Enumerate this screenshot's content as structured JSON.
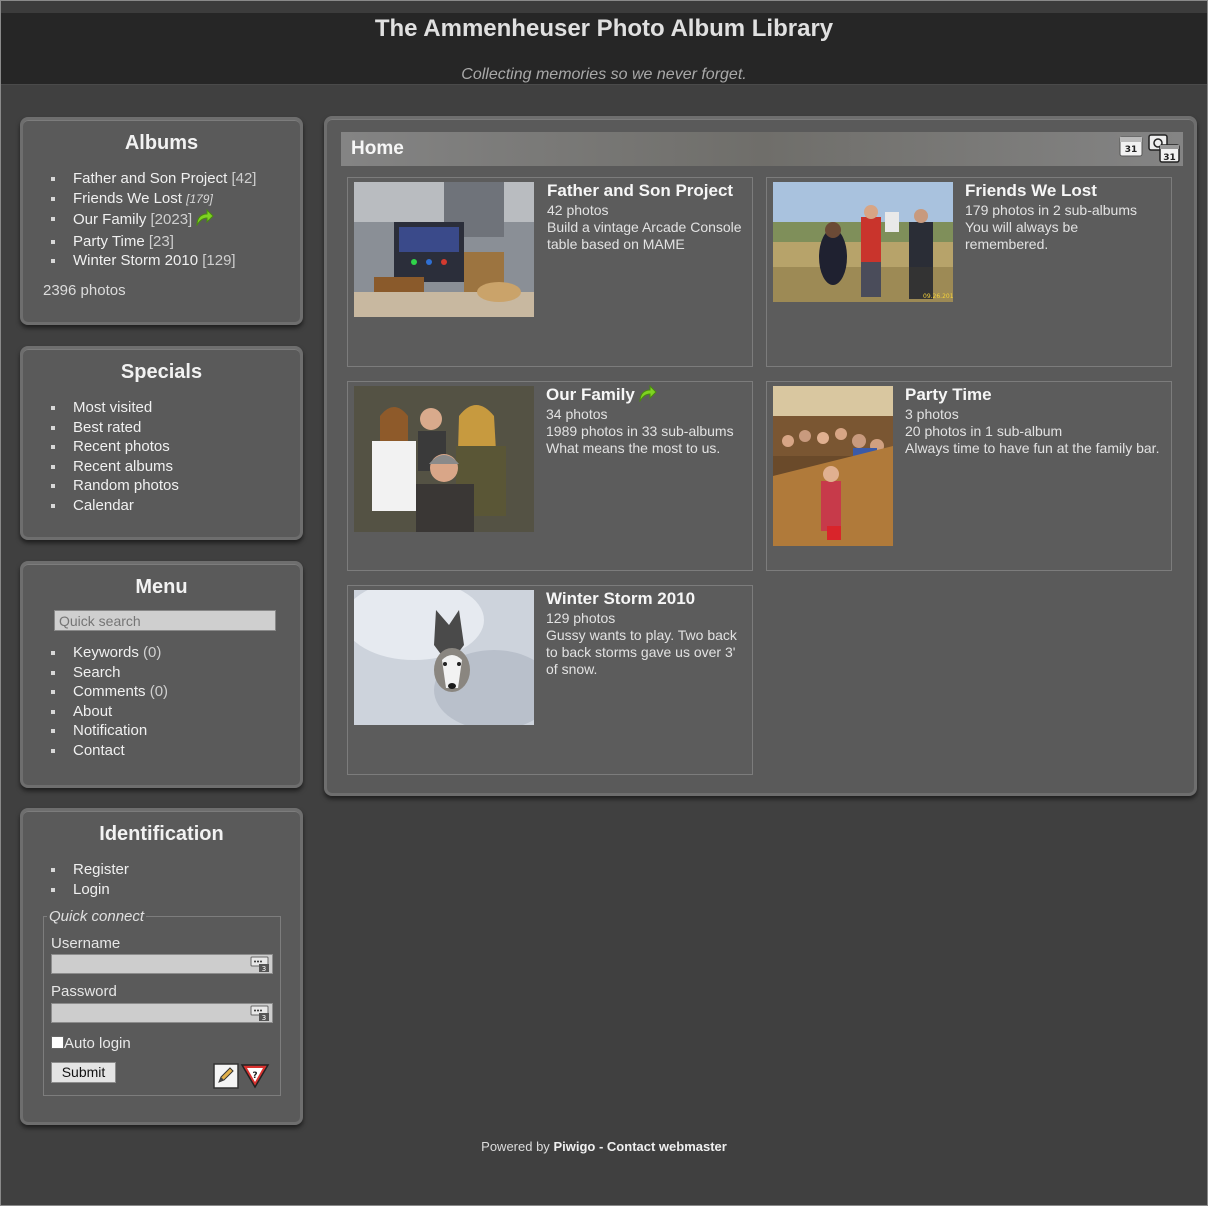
{
  "header": {
    "title": "The Ammenheuser Photo Album Library",
    "tagline": "Collecting memories so we never forget."
  },
  "albums_box": {
    "title": "Albums",
    "items": [
      {
        "label": "Father and Son Project",
        "count": "[42]"
      },
      {
        "label": "Friends We Lost",
        "count": "[179]"
      },
      {
        "label": "Our Family",
        "count": "[2023]"
      },
      {
        "label": "Party Time",
        "count": "[23]"
      },
      {
        "label": "Winter Storm 2010",
        "count": "[129]"
      }
    ],
    "total": "2396 photos"
  },
  "specials_box": {
    "title": "Specials",
    "items": [
      "Most visited",
      "Best rated",
      "Recent photos",
      "Recent albums",
      "Random photos",
      "Calendar"
    ]
  },
  "menu_box": {
    "title": "Menu",
    "search_placeholder": "Quick search",
    "items": [
      {
        "label": "Keywords",
        "count": "(0)"
      },
      {
        "label": "Search",
        "count": ""
      },
      {
        "label": "Comments",
        "count": "(0)"
      },
      {
        "label": "About",
        "count": ""
      },
      {
        "label": "Notification",
        "count": ""
      },
      {
        "label": "Contact",
        "count": ""
      }
    ]
  },
  "ident_box": {
    "title": "Identification",
    "items": [
      "Register",
      "Login"
    ],
    "quick_connect": {
      "legend": "Quick connect",
      "username_label": "Username",
      "password_label": "Password",
      "auto_login_label": "Auto login",
      "submit_label": "Submit"
    }
  },
  "content": {
    "title": "Home",
    "albums": [
      {
        "name": "Father and Son Project",
        "line1": "42 photos",
        "line2": "Build a vintage Arcade Console table based on MAME",
        "line3": ""
      },
      {
        "name": "Friends We Lost",
        "line1": "179 photos in 2 sub-albums",
        "line2": "You will always be remembered.",
        "line3": ""
      },
      {
        "name": "Our Family",
        "line1": "34 photos",
        "line2": "1989 photos in 33 sub-albums",
        "line3": "What means the most to us."
      },
      {
        "name": "Party Time",
        "line1": "3 photos",
        "line2": "20 photos in 1 sub-album",
        "line3": "Always time to have fun at the family bar."
      },
      {
        "name": "Winter Storm 2010",
        "line1": "129 photos",
        "line2": "Gussy wants to play. Two back to back storms gave us over 3' of snow.",
        "line3": ""
      }
    ]
  },
  "footer": {
    "powered_prefix": "Powered by",
    "powered_link": "Piwigo",
    "separator": "-",
    "contact_link": "Contact webmaster"
  },
  "icons": {
    "share": "green-arrow-icon",
    "calendar": "calendar-icon",
    "calendar_post": "calendar-post-icon",
    "register": "register-pencil-icon",
    "help": "help-icon"
  }
}
